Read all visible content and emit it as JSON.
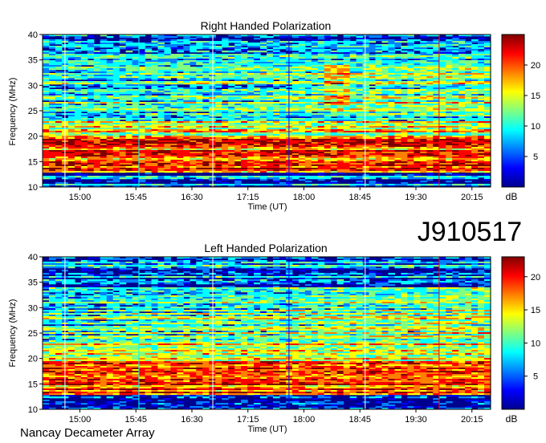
{
  "observation_id": "J910517",
  "instrument": "Nancay Decameter Array",
  "colormap": [
    "#00008f",
    "#0000ff",
    "#0080ff",
    "#00ffff",
    "#80ff80",
    "#ffff00",
    "#ff8000",
    "#ff0000",
    "#800000"
  ],
  "chart_data": [
    {
      "type": "heatmap",
      "title": "Right Handed Polarization",
      "xlabel": "Time (UT)",
      "ylabel": "Frequency (MHz)",
      "xticks": [
        "15:00",
        "15:45",
        "16:30",
        "17:15",
        "18:00",
        "18:45",
        "19:30",
        "20:15"
      ],
      "xlim": [
        "14:30",
        "20:30"
      ],
      "ylim": [
        10,
        40
      ],
      "yticks": [
        10,
        15,
        20,
        25,
        30,
        35,
        40
      ],
      "colorbar": {
        "label": "dB",
        "range": [
          0,
          25
        ],
        "ticks": [
          5,
          10,
          15,
          20
        ]
      }
    },
    {
      "type": "heatmap",
      "title": "Left Handed Polarization",
      "xlabel": "Time (UT)",
      "ylabel": "Frequency (MHz)",
      "xticks": [
        "15:00",
        "15:45",
        "16:30",
        "17:15",
        "18:00",
        "18:45",
        "19:30",
        "20:15"
      ],
      "xlim": [
        "14:30",
        "20:30"
      ],
      "ylim": [
        10,
        40
      ],
      "yticks": [
        10,
        15,
        20,
        25,
        30,
        35,
        40
      ],
      "colorbar": {
        "label": "dB",
        "range": [
          0,
          23
        ],
        "ticks": [
          5,
          10,
          15,
          20
        ]
      }
    }
  ]
}
